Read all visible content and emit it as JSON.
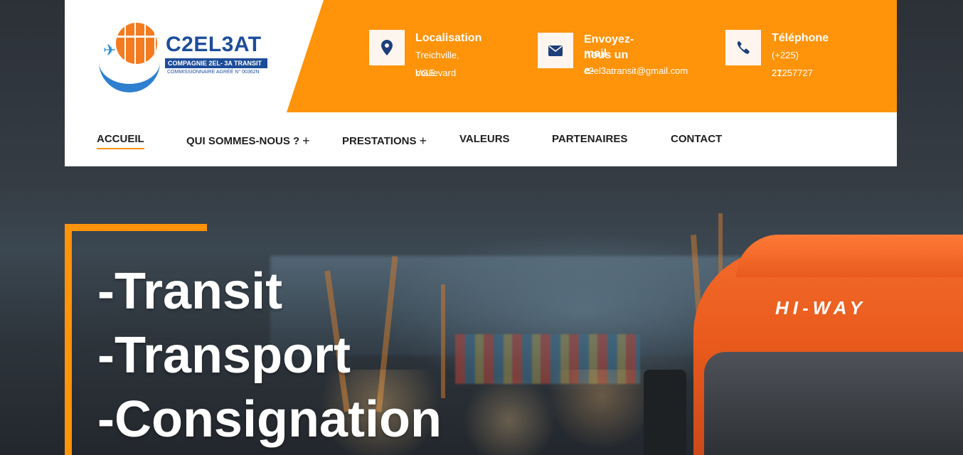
{
  "brand": {
    "name": "C2EL3AT",
    "subtitle": "COMPAGNIE 2EL- 3A TRANSIT",
    "agreement": "COMMISSIONNAIRE AGRÉÉ N° 00362N"
  },
  "contact": {
    "location": {
      "title": "Localisation",
      "line1": "Treichville, boulevard",
      "line2": "VGE",
      "icon": "map-pin-icon"
    },
    "email": {
      "title_line1": "Envoyez-nous un e-",
      "title_line2": "mail",
      "address": "c2el3atransit@gmail.com",
      "icon": "envelope-icon"
    },
    "phone": {
      "title": "Téléphone",
      "line1": "(+225) 27",
      "line2": "21257727",
      "icon": "phone-icon"
    }
  },
  "nav": {
    "items": [
      {
        "label": "ACCUEIL",
        "active": true
      },
      {
        "label": "QUI SOMMES-NOUS ?",
        "has_submenu": true
      },
      {
        "label": "PRESTATIONS",
        "has_submenu": true
      },
      {
        "label": "VALEURS"
      },
      {
        "label": "PARTENAIRES"
      },
      {
        "label": "CONTACT"
      }
    ],
    "submenu_symbol": "+"
  },
  "hero": {
    "lines": [
      "-Transit",
      "-Transport",
      "-Consignation"
    ],
    "truck_brand": "HI-WAY"
  },
  "colors": {
    "accent": "#ff930a",
    "brand_blue": "#1d4d9a",
    "icon_blue": "#1d3f7a"
  }
}
